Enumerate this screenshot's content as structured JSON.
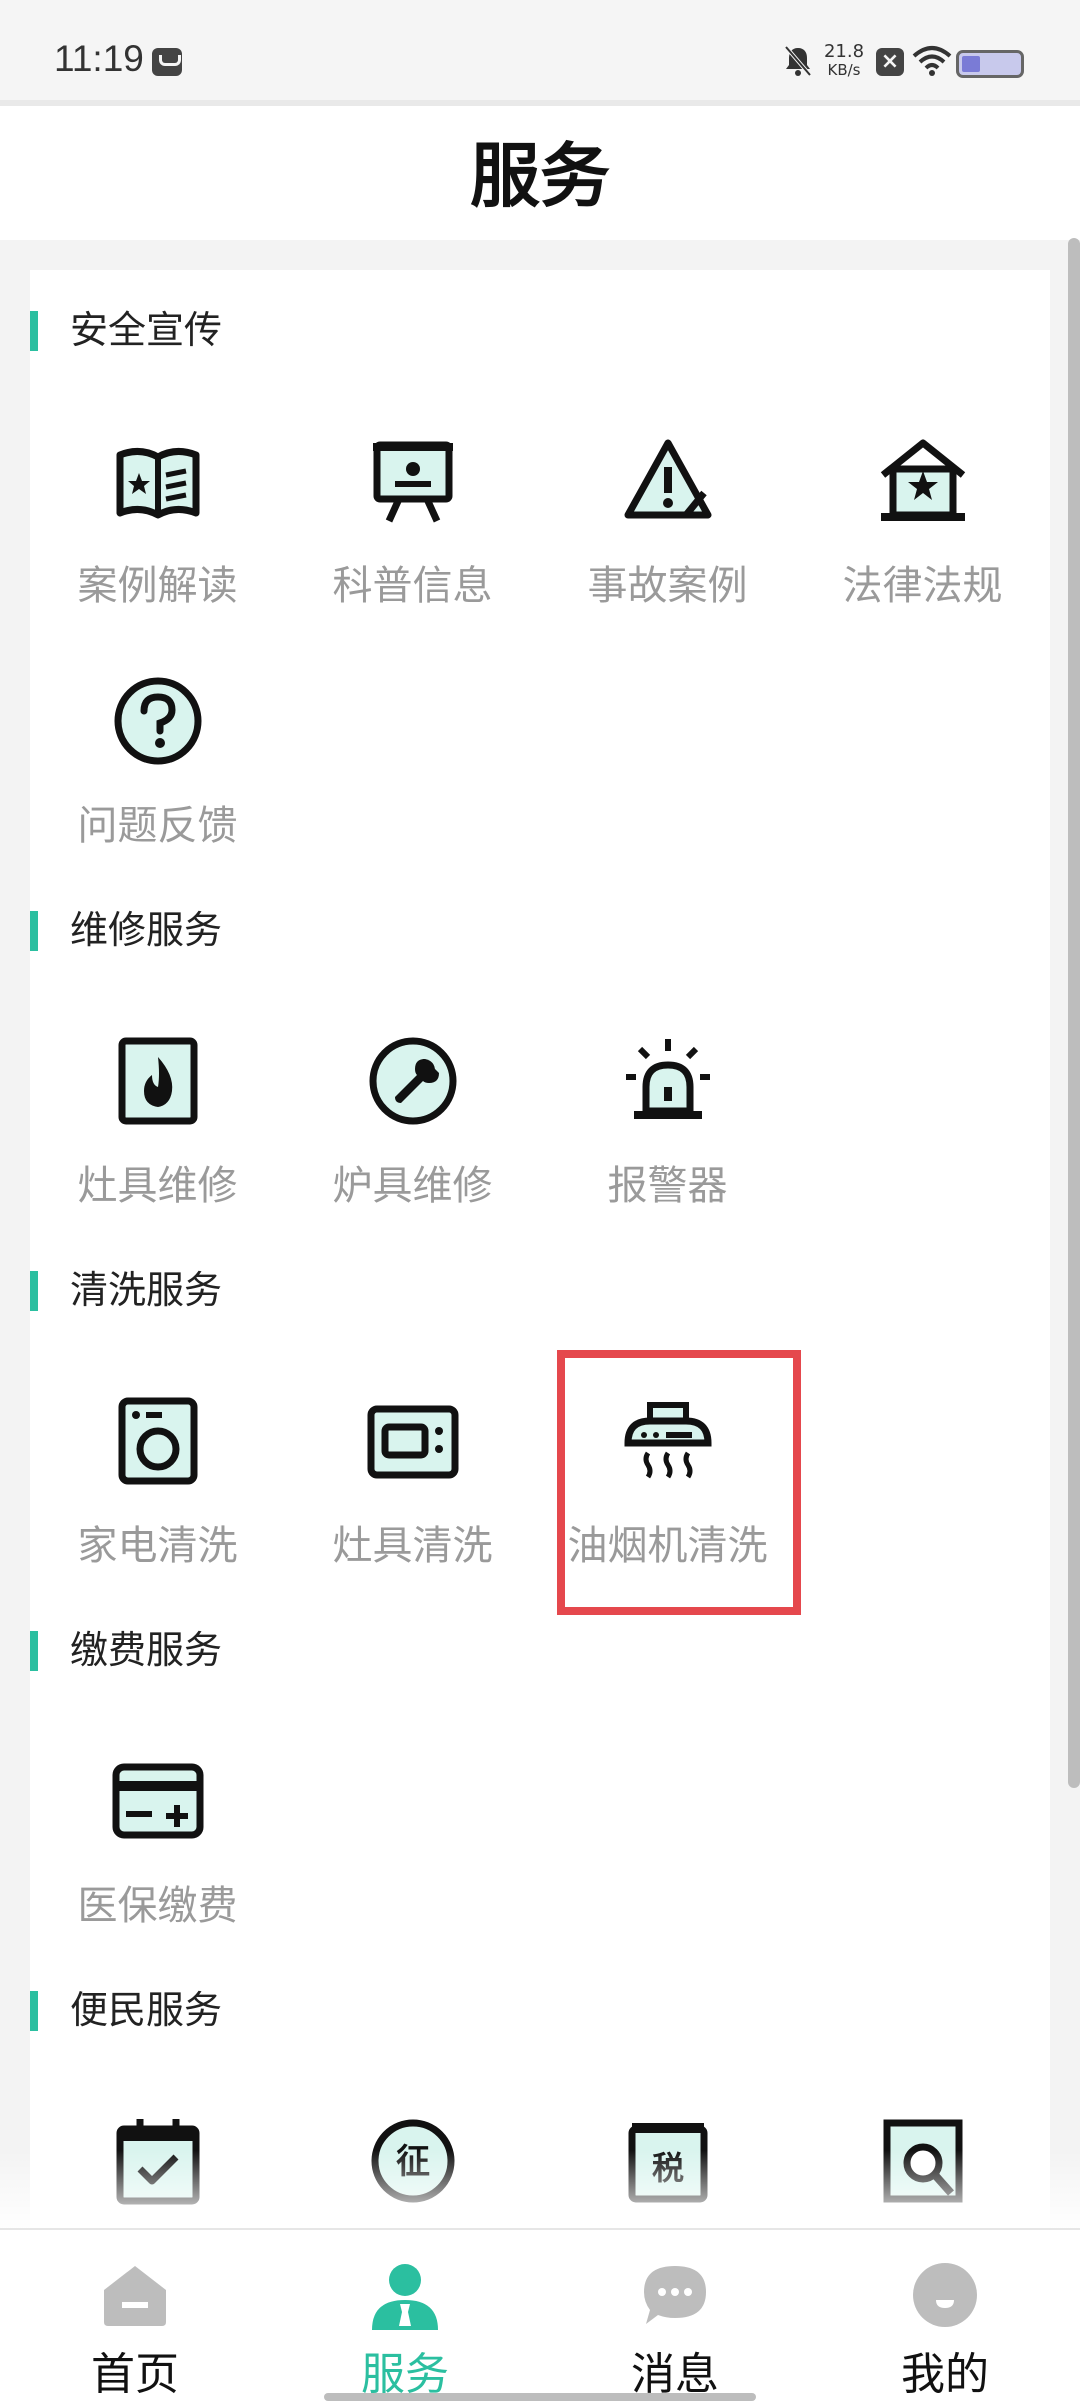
{
  "status_bar": {
    "time": "11:19",
    "net_speed_value": "21.8",
    "net_speed_unit": "KB/s",
    "icons": [
      "message-icon",
      "mute-icon",
      "close-box-icon",
      "wifi-icon",
      "battery-icon"
    ]
  },
  "header": {
    "title": "服务"
  },
  "sections": [
    {
      "title": "安全宣传",
      "items": [
        {
          "label": "案例解读",
          "icon": "book-star-icon"
        },
        {
          "label": "科普信息",
          "icon": "easel-icon"
        },
        {
          "label": "事故案例",
          "icon": "warning-icon"
        },
        {
          "label": "法律法规",
          "icon": "house-star-icon"
        },
        {
          "label": "问题反馈",
          "icon": "question-icon"
        }
      ]
    },
    {
      "title": "维修服务",
      "items": [
        {
          "label": "灶具维修",
          "icon": "flame-icon"
        },
        {
          "label": "炉具维修",
          "icon": "wrench-icon"
        },
        {
          "label": "报警器",
          "icon": "alarm-icon"
        }
      ]
    },
    {
      "title": "清洗服务",
      "items": [
        {
          "label": "家电清洗",
          "icon": "washer-icon"
        },
        {
          "label": "灶具清洗",
          "icon": "oven-icon"
        },
        {
          "label": "油烟机清洗",
          "icon": "range-hood-icon"
        }
      ]
    },
    {
      "title": "缴费服务",
      "items": [
        {
          "label": "医保缴费",
          "icon": "card-plus-icon"
        }
      ]
    },
    {
      "title": "便民服务",
      "items": [
        {
          "label": "",
          "icon": "calendar-check-icon"
        },
        {
          "label": "",
          "icon": "stamp-zheng-icon"
        },
        {
          "label": "",
          "icon": "tax-icon"
        },
        {
          "label": "",
          "icon": "search-doc-icon"
        }
      ]
    }
  ],
  "tabs": [
    {
      "label": "首页",
      "icon": "home-icon",
      "active": false
    },
    {
      "label": "服务",
      "icon": "user-service-icon",
      "active": true
    },
    {
      "label": "消息",
      "icon": "chat-icon",
      "active": false
    },
    {
      "label": "我的",
      "icon": "profile-icon",
      "active": false
    }
  ],
  "colors": {
    "accent": "#2bbfa0",
    "highlight": "#e5484d",
    "label_gray": "#9a9a9a"
  }
}
